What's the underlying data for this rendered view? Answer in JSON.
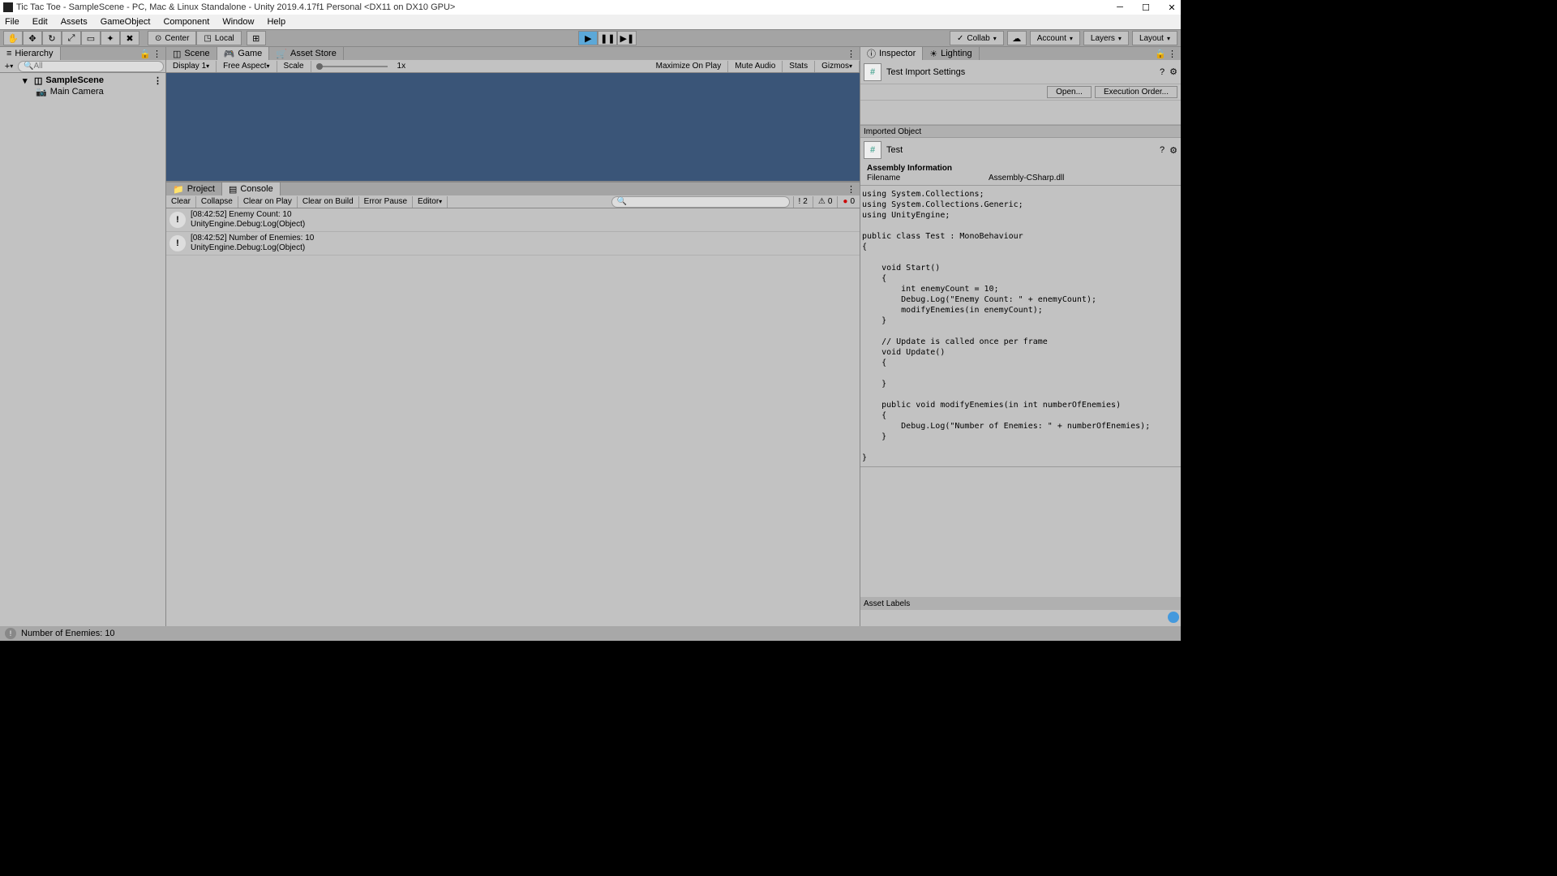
{
  "window": {
    "title": "Tic Tac Toe - SampleScene - PC, Mac & Linux Standalone - Unity 2019.4.17f1 Personal <DX11 on DX10 GPU>"
  },
  "menubar": [
    "File",
    "Edit",
    "Assets",
    "GameObject",
    "Component",
    "Window",
    "Help"
  ],
  "toolbar": {
    "center": "Center",
    "local": "Local",
    "collab": "Collab",
    "account": "Account",
    "layers": "Layers",
    "layout": "Layout"
  },
  "hierarchy": {
    "tab": "Hierarchy",
    "search_placeholder": "All",
    "scene": "SampleScene",
    "items": [
      "Main Camera"
    ]
  },
  "game": {
    "tabs": {
      "scene": "Scene",
      "game": "Game",
      "asset_store": "Asset Store"
    },
    "display": "Display 1",
    "aspect": "Free Aspect",
    "scale_label": "Scale",
    "scale_value": "1x",
    "maximize": "Maximize On Play",
    "mute": "Mute Audio",
    "stats": "Stats",
    "gizmos": "Gizmos"
  },
  "bottom": {
    "tabs": {
      "project": "Project",
      "console": "Console"
    },
    "buttons": {
      "clear": "Clear",
      "collapse": "Collapse",
      "clear_play": "Clear on Play",
      "clear_build": "Clear on Build",
      "error_pause": "Error Pause",
      "editor": "Editor"
    },
    "counts": {
      "info": "2",
      "warn": "0",
      "error": "0"
    },
    "entries": [
      {
        "time": "[08:42:52]",
        "msg": "Enemy Count: 10",
        "stack": "UnityEngine.Debug:Log(Object)"
      },
      {
        "time": "[08:42:52]",
        "msg": "Number of Enemies: 10",
        "stack": "UnityEngine.Debug:Log(Object)"
      }
    ]
  },
  "inspector": {
    "tabs": {
      "inspector": "Inspector",
      "lighting": "Lighting"
    },
    "title": "Test Import Settings",
    "open": "Open...",
    "exec_order": "Execution Order...",
    "imported_object": "Imported Object",
    "object_name": "Test",
    "assembly_info": "Assembly Information",
    "filename_label": "Filename",
    "filename_value": "Assembly-CSharp.dll",
    "code": "using System.Collections;\nusing System.Collections.Generic;\nusing UnityEngine;\n\npublic class Test : MonoBehaviour\n{\n\n    void Start()\n    {\n        int enemyCount = 10;\n        Debug.Log(\"Enemy Count: \" + enemyCount);\n        modifyEnemies(in enemyCount);\n    }\n\n    // Update is called once per frame\n    void Update()\n    {\n        \n    }\n\n    public void modifyEnemies(in int numberOfEnemies)\n    {\n        Debug.Log(\"Number of Enemies: \" + numberOfEnemies);\n    }\n\n}",
    "asset_labels": "Asset Labels"
  },
  "status": {
    "message": "Number of Enemies: 10"
  }
}
